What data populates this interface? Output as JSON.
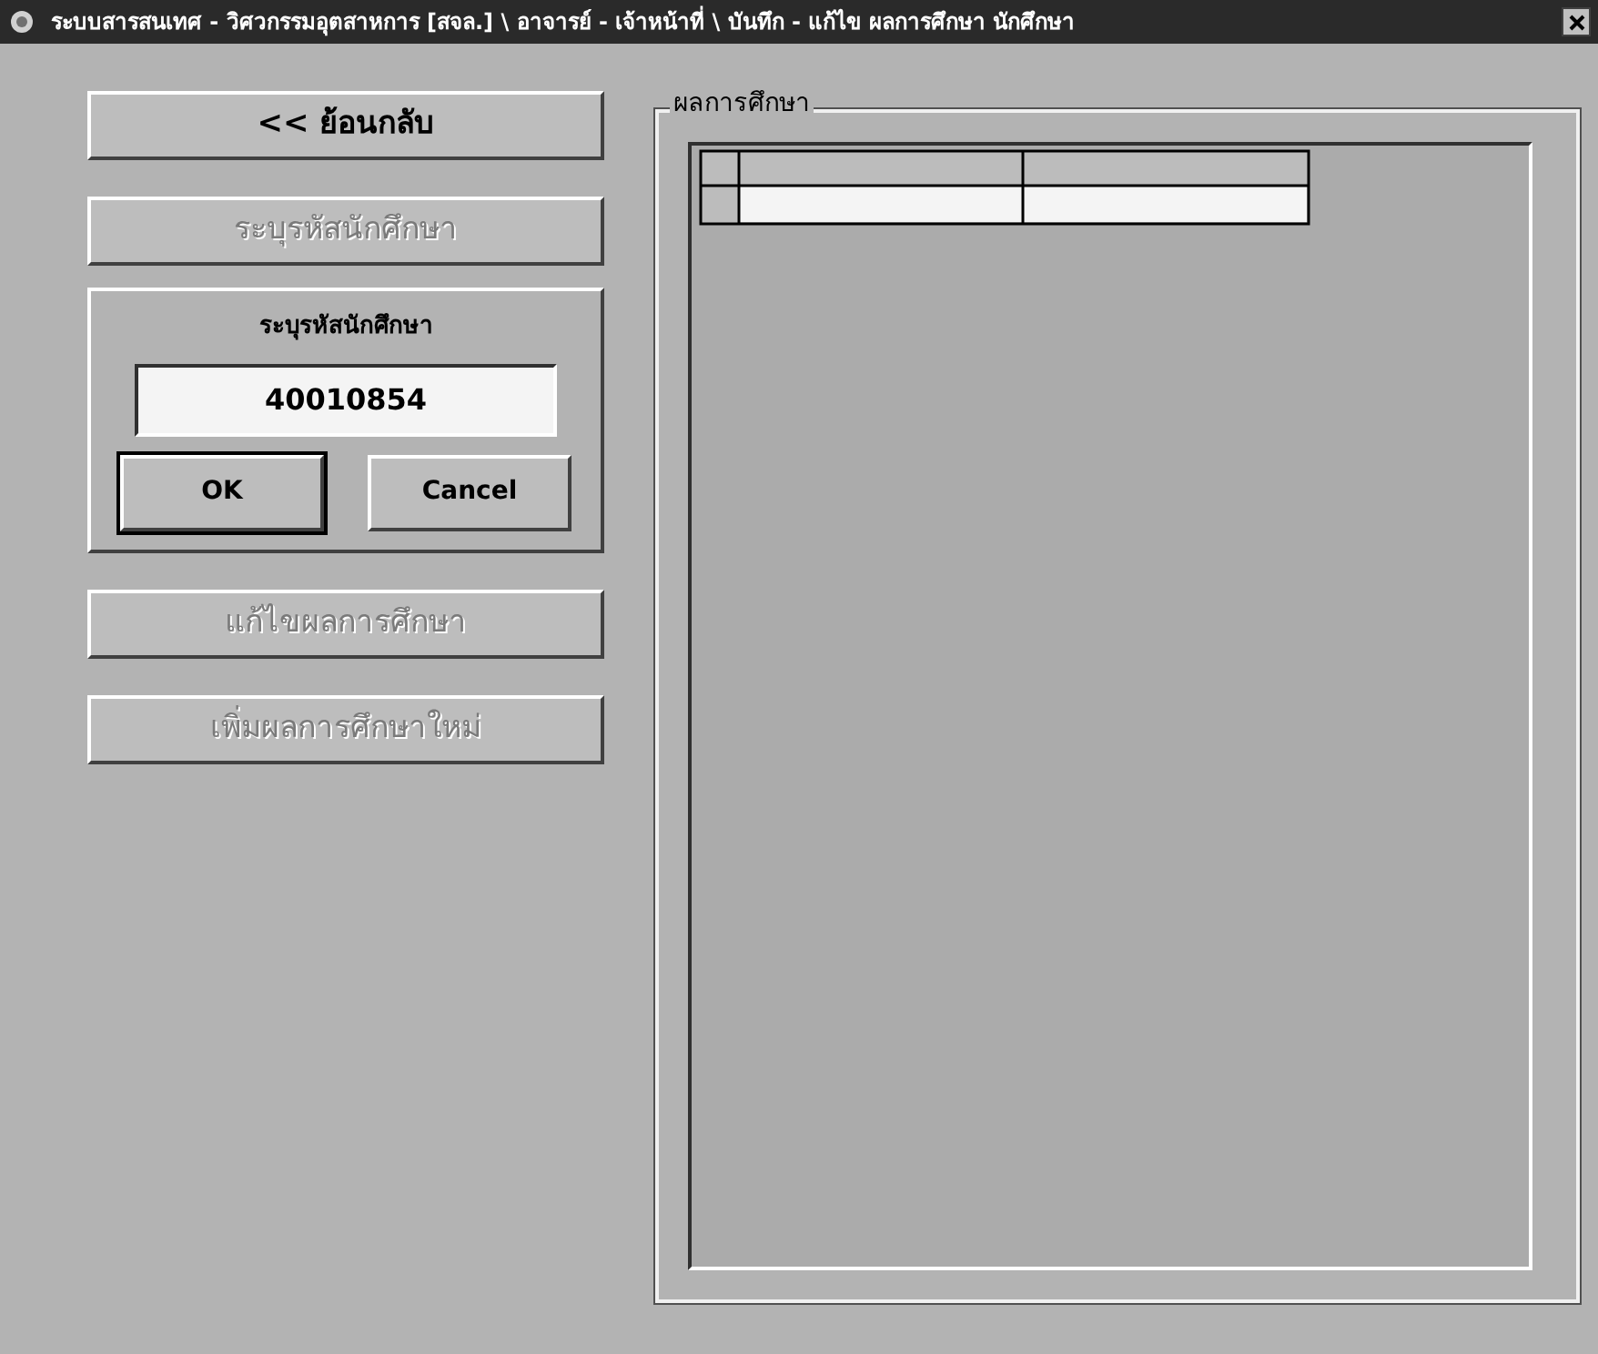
{
  "window": {
    "title": "ระบบสารสนเทศ - วิศวกรรมอุตสาหการ [สจล.] \\ อาจารย์ - เจ้าหน้าที่ \\ บันทึก - แก้ไข ผลการศึกษา นักศึกษา"
  },
  "top_buttons": [
    {
      "label": "<< ย้อนกลับ",
      "disabled": false
    },
    {
      "label": "ระบุรหัสนักศึกษา",
      "disabled": true
    }
  ],
  "student_id_box": {
    "title": "ระบุรหัสนักศึกษา",
    "value": "40010854",
    "buttons": [
      {
        "label": "OK",
        "default": true
      },
      {
        "label": "Cancel",
        "default": false
      }
    ]
  },
  "bottom_buttons": [
    {
      "label": "แก้ไขผลการศึกษา",
      "disabled": true
    },
    {
      "label": "เพิ่มผลการศึกษาใหม่",
      "disabled": true
    }
  ],
  "results_group": {
    "title": "ผลการศึกษา"
  }
}
